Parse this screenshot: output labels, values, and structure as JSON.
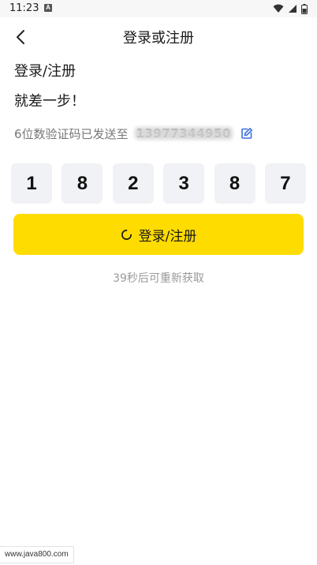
{
  "status_bar": {
    "time": "11:23",
    "notification_badge": "A",
    "icons": [
      "wifi-icon",
      "signal-icon",
      "battery-icon"
    ]
  },
  "nav": {
    "title": "登录或注册",
    "back_icon": "chevron-left-icon"
  },
  "main": {
    "heading": "登录/注册",
    "subheading": "就差一步！",
    "sent_text": "6位数验证码已发送至",
    "phone_masked": "13977344950",
    "edit_icon": "edit-icon",
    "code_digits": [
      "1",
      "8",
      "2",
      "3",
      "8",
      "7"
    ],
    "login_button_label": "登录/注册",
    "resend_text": "39秒后可重新获取"
  },
  "watermark": "www.java800.com",
  "colors": {
    "accent": "#ffdc00",
    "code_box_bg": "#f1f2f5",
    "edit_icon": "#3b6fe0",
    "muted_text": "#9a9a9a"
  }
}
